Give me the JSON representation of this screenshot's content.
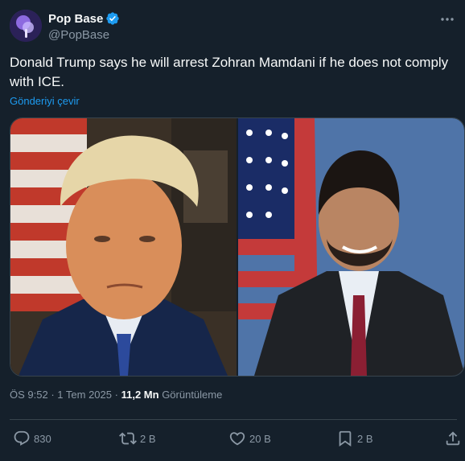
{
  "author": {
    "display_name": "Pop Base",
    "handle": "@PopBase",
    "avatar_icon": "pop-base-avatar",
    "verified": true,
    "verified_color": "#1d9bf0"
  },
  "tweet": {
    "text": "Donald Trump says he will arrest Zohran Mamdani if he does not comply with ICE.",
    "translate_label": "Gönderiyi çevir"
  },
  "media": {
    "images": [
      {
        "icon": "portrait-photo-left"
      },
      {
        "icon": "portrait-photo-right"
      }
    ]
  },
  "meta": {
    "time": "ÖS 9:52",
    "separator": "·",
    "date": "1 Tem 2025",
    "views_count": "11,2 Mn",
    "views_label": "Görüntüleme"
  },
  "actions": {
    "replies": "830",
    "reposts": "2 B",
    "likes": "20 B",
    "bookmarks": "2 B"
  },
  "colors": {
    "background": "#15202b",
    "text_primary": "#f7f9f9",
    "text_secondary": "#8b98a5",
    "link": "#1d9bf0",
    "border": "#38444d"
  }
}
